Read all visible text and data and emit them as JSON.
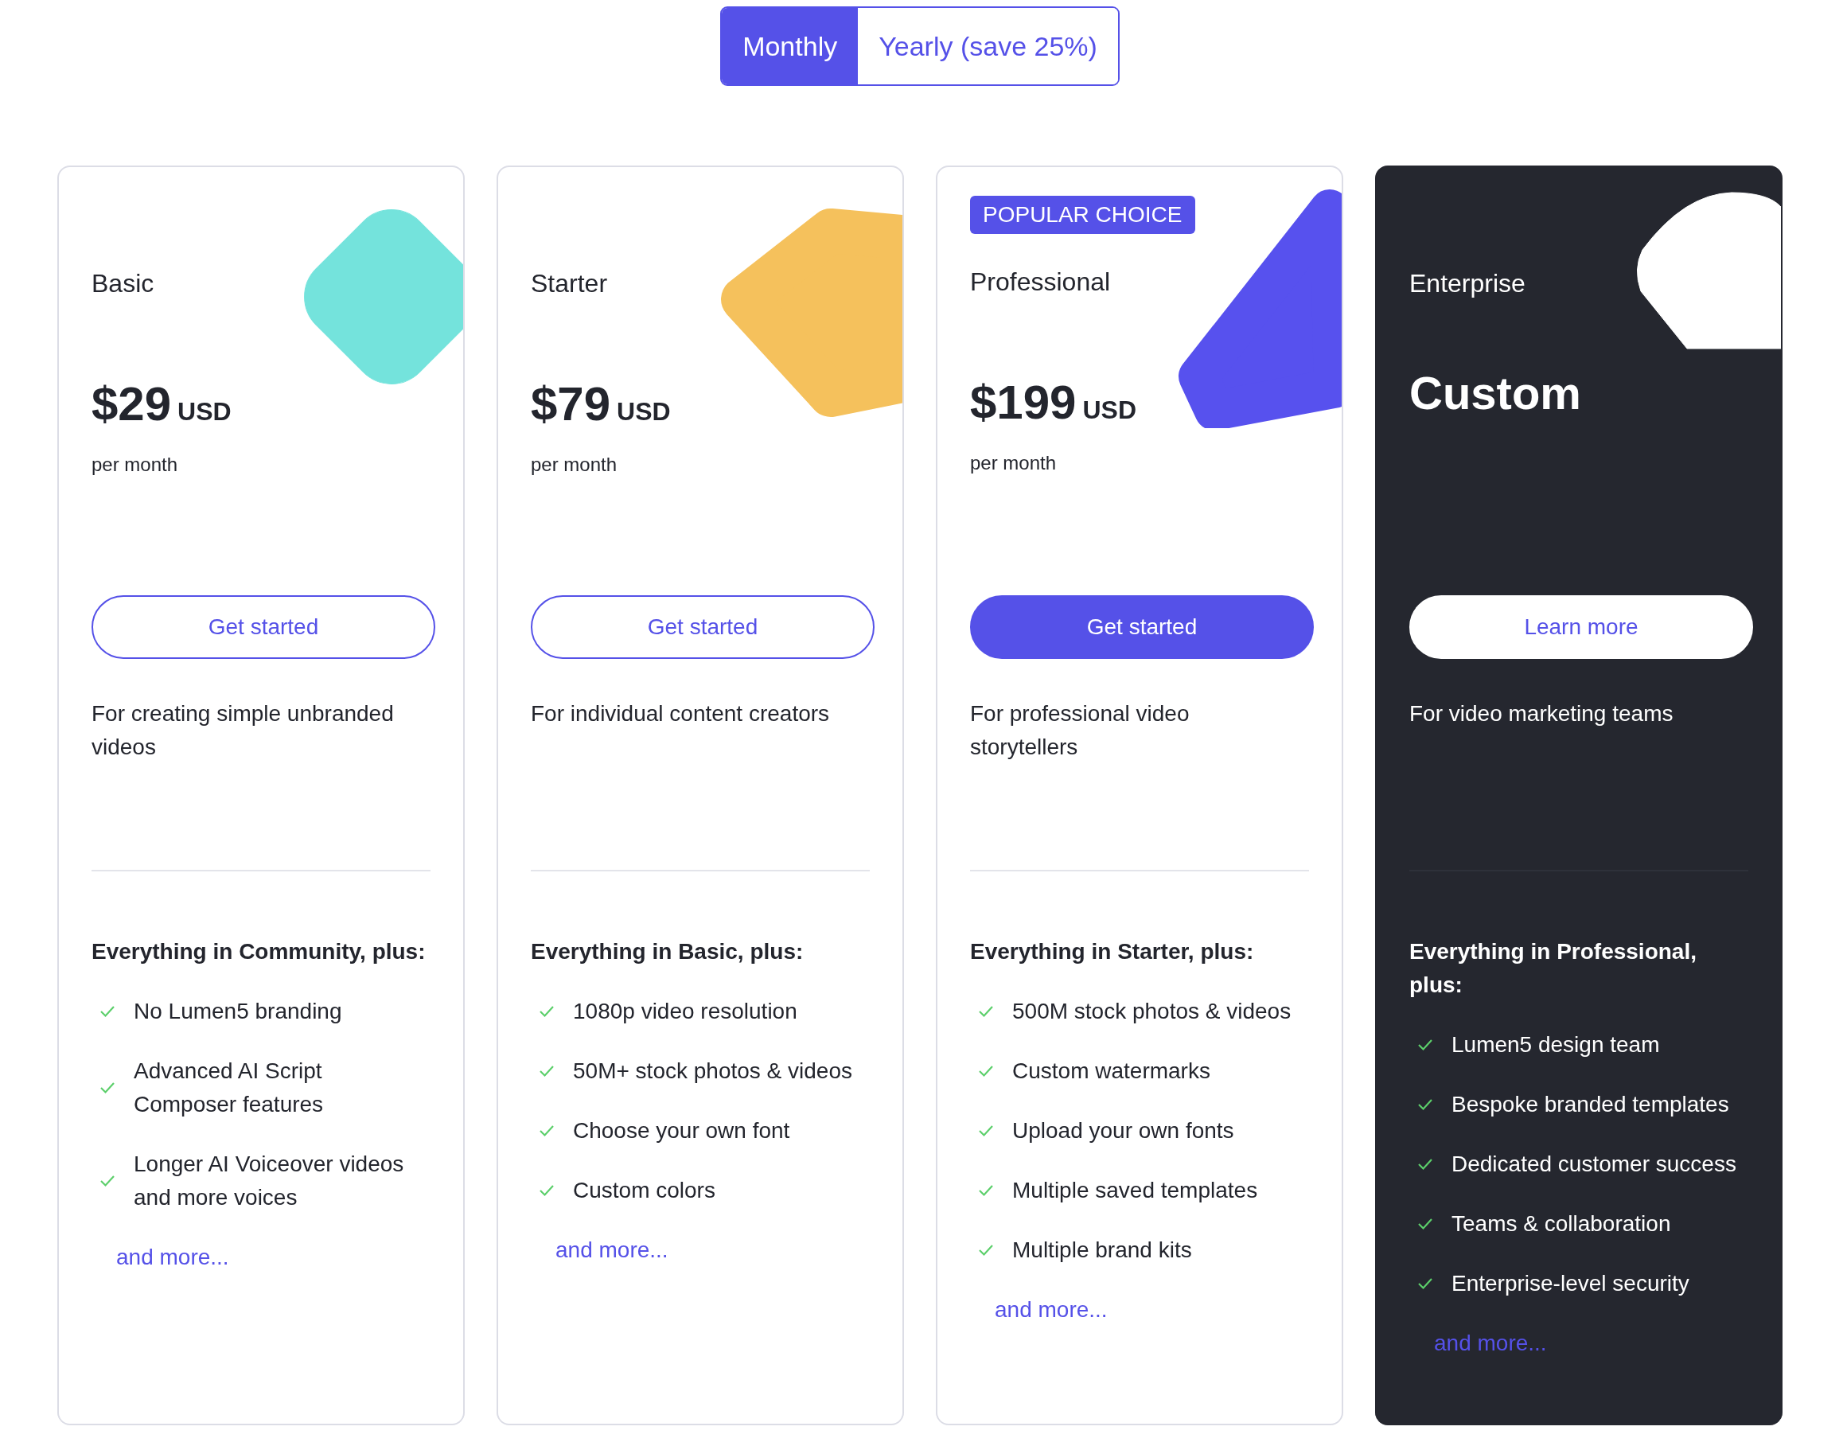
{
  "billing_toggle": [
    {
      "label": "Monthly",
      "selected": true
    },
    {
      "label": "Yearly (save 25%)",
      "selected": false
    }
  ],
  "plans": [
    {
      "name": "Basic",
      "kind": "standard",
      "decoration": {
        "kind": "diamond",
        "color": "#74e3dc"
      },
      "price": "$29",
      "currency": "USD",
      "period": "per month",
      "button": {
        "label": "Get started",
        "kind": "outline"
      },
      "description": "For creating simple unbranded videos",
      "features_heading": "Everything in Community, plus:",
      "features": [
        "No Lumen5 branding",
        "Advanced AI Script Composer features",
        "Longer AI Voiceover videos and more voices"
      ],
      "more_link": "and more..."
    },
    {
      "name": "Starter",
      "kind": "standard",
      "decoration": {
        "kind": "arrow",
        "color": "#f5c15c"
      },
      "price": "$79",
      "currency": "USD",
      "period": "per month",
      "button": {
        "label": "Get started",
        "kind": "outline"
      },
      "description": "For individual content creators",
      "features_heading": "Everything in Basic, plus:",
      "features": [
        "1080p video resolution",
        "50M+ stock photos & videos",
        "Choose your own font",
        "Custom colors"
      ],
      "more_link": "and more..."
    },
    {
      "name": "Professional",
      "kind": "standard",
      "badge": "POPULAR CHOICE",
      "decoration": {
        "kind": "slant",
        "color": "#5751ee"
      },
      "price": "$199",
      "currency": "USD",
      "period": "per month",
      "button": {
        "label": "Get started",
        "kind": "filled"
      },
      "description": "For professional video storytellers",
      "features_heading": "Everything in Starter, plus:",
      "features": [
        "500M stock photos & videos",
        "Custom watermarks",
        "Upload your own fonts",
        "Multiple saved templates",
        "Multiple brand kits"
      ],
      "more_link": "and more..."
    },
    {
      "name": "Enterprise",
      "kind": "dark",
      "decoration": {
        "kind": "hexagon",
        "color": "#ffffff"
      },
      "price": "Custom",
      "button": {
        "label": "Learn more",
        "kind": "light"
      },
      "description": "For video marketing teams",
      "features_heading": "Everything in Professional, plus:",
      "features": [
        "Lumen5 design team",
        "Bespoke branded templates",
        "Dedicated customer success",
        "Teams & collaboration",
        "Enterprise-level security"
      ],
      "more_link": "and more..."
    }
  ]
}
